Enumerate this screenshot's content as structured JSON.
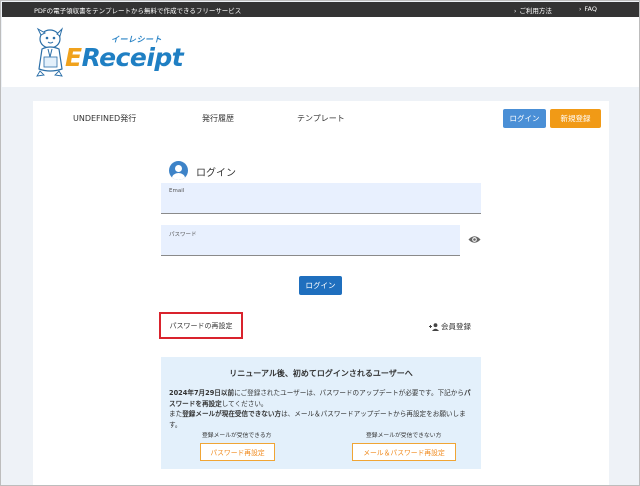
{
  "topbar": {
    "tagline": "PDFの電子領収書をテンプレートから無料で作成できるフリーサービス",
    "usage": "ご利用方法",
    "faq": "FAQ"
  },
  "logo": {
    "kana": "イーレシート",
    "word_e": "E",
    "word_rest": "Receipt"
  },
  "nav": {
    "items": [
      "UNDEFINED発行",
      "発行履歴",
      "テンプレート"
    ],
    "login": "ログイン",
    "signup": "新規登録"
  },
  "login_form": {
    "title": "ログイン",
    "email_label": "Email",
    "email_value": "",
    "password_label": "パスワード",
    "password_value": "",
    "submit": "ログイン",
    "reset_link": "パスワードの再設定",
    "member_link": "会員登録"
  },
  "notice": {
    "title": "リニューアル後、初めてログインされるユーザーへ",
    "p1_bold": "2024年7月29日以前",
    "p1_mid": "にご登録されたユーザーは、パスワードのアップデートが必要です。下記から",
    "p1_bold2": "パスワードを再設定",
    "p1_end": "してください。",
    "p2_pre": "また",
    "p2_bold": "登録メールが現在受信できない方",
    "p2_end": "は、メール＆パスワードアップデートから再設定をお願いします。",
    "left_label": "登録メールが受信できる方",
    "left_button": "パスワード再設定",
    "right_label": "登録メールが受信できない方",
    "right_button": "メール＆パスワード再設定"
  },
  "colors": {
    "topbar": "#333333",
    "primary": "#1f6fbe",
    "login_button": "#4a8fd6",
    "signup_button": "#f19a16",
    "highlight_border": "#d9232d",
    "notice_bg": "#e3f0fb"
  }
}
